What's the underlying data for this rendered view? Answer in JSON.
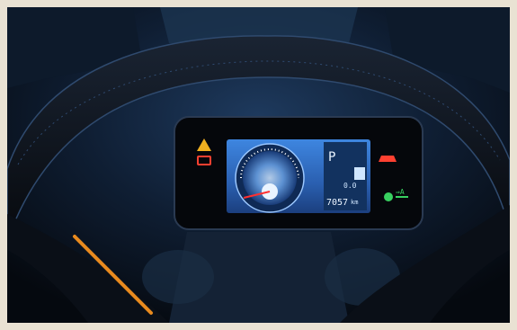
{
  "scene": {
    "subject": "instrument-cluster",
    "colors": {
      "background": "#0a1019",
      "border": "#e9e2d3",
      "screen_glow": "#3e7fd8",
      "warning_amber": "#f0b020",
      "warning_red": "#ff4030",
      "indicator_green": "#38d060",
      "accent_orange": "#e88a1e"
    }
  },
  "display": {
    "gear": "P",
    "trip": "0.0",
    "odometer": "7057",
    "unit": "km",
    "indicator_right": "⇒A"
  },
  "icons": {
    "left_top": "triangle-warning-icon",
    "left_bottom": "battery-warning-icon",
    "right_top": "car-warning-icon",
    "right_bottom": "headlight-indicator-icon"
  }
}
